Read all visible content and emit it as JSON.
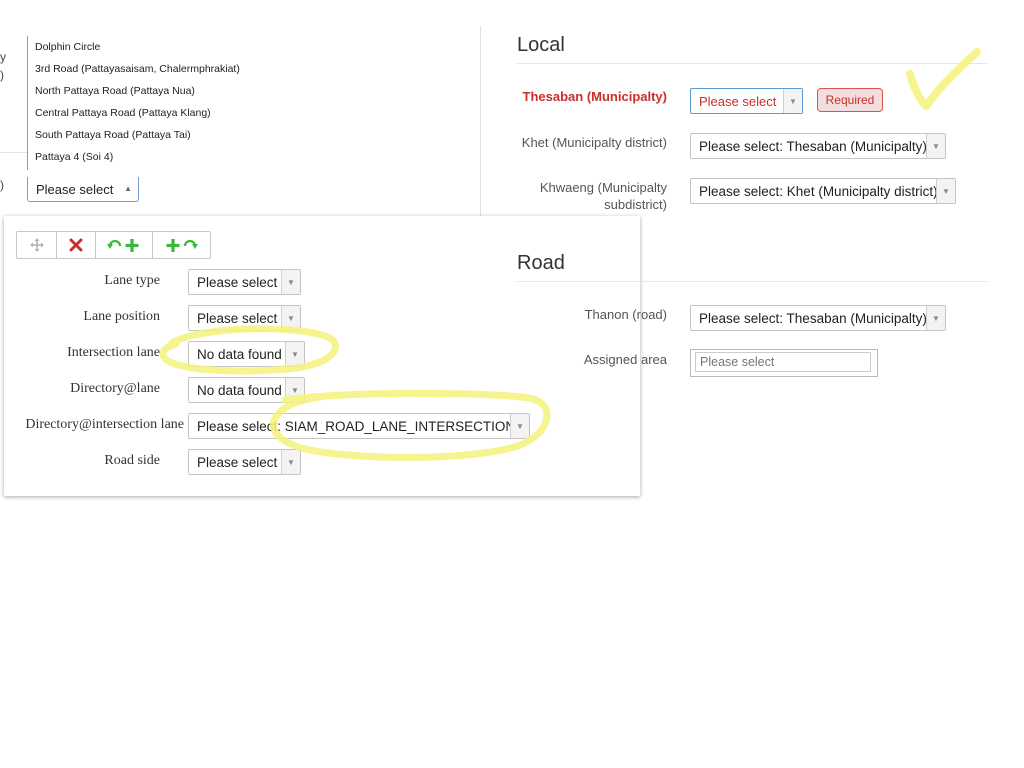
{
  "left_fragments": {
    "frag1": "y",
    "frag2": ")",
    "frag3": ")"
  },
  "dropdown": {
    "items": [
      "Dolphin Circle",
      "3rd Road (Pattayasaisam, Chalermphrakiat)",
      "North Pattaya Road (Pattaya Nua)",
      "Central Pattaya Road (Pattaya Klang)",
      "South Pattaya Road (Pattaya Tai)",
      "Pattaya  4 (Soi 4)"
    ],
    "selected_label": "Please select"
  },
  "panel": {
    "toolbar": {
      "move_icon": "move-icon",
      "delete_icon": "close-icon",
      "undo_add_icon": "undo-add-icon",
      "add_redo_icon": "add-redo-icon"
    },
    "fields": [
      {
        "label": "Lane type",
        "value": "Please select"
      },
      {
        "label": "Lane position",
        "value": "Please select"
      },
      {
        "label": "Intersection lane",
        "value": "No data found"
      },
      {
        "label": "Directory@lane",
        "value": "No data found"
      },
      {
        "label": "Directory@intersection lane",
        "value": "Please select: SIAM_ROAD_LANE_INTERSECTION"
      },
      {
        "label": "Road side",
        "value": "Please select"
      }
    ]
  },
  "local": {
    "title": "Local",
    "thesaban": {
      "label": "Thesaban (Municipalty)",
      "value": "Please select",
      "badge": "Required"
    },
    "khet": {
      "label": "Khet (Municipalty district)",
      "value": "Please select: Thesaban (Municipalty)"
    },
    "khwaeng": {
      "label_line1": "Khwaeng (Municipalty",
      "label_line2": "subdistrict)",
      "value": "Please select: Khet (Municipalty district)"
    }
  },
  "road": {
    "title": "Road",
    "thanon": {
      "label": "Thanon (road)",
      "value": "Please select: Thesaban (Municipalty)"
    },
    "assigned": {
      "label": "Assigned area",
      "placeholder": "Please select"
    }
  },
  "colors": {
    "required_red": "#c9302c",
    "highlight_yellow": "#f4f27a",
    "add_green": "#3cb83c",
    "delete_red": "#c9302c"
  }
}
